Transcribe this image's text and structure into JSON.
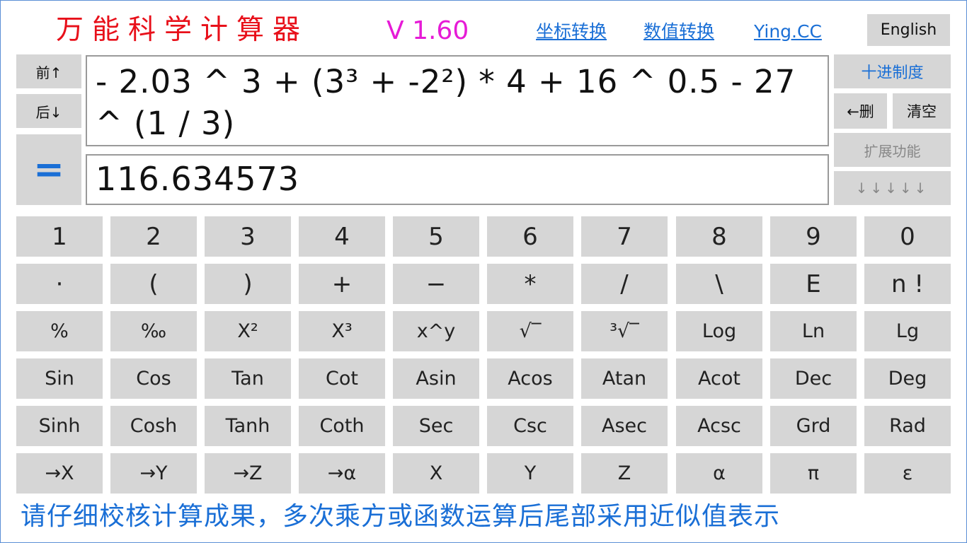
{
  "header": {
    "title": "万能科学计算器",
    "version": "V 1.60",
    "links": [
      "坐标转换",
      "数值转换",
      "Ying.CC"
    ],
    "language_button": "English"
  },
  "left_panel": {
    "prev_label": "前↑",
    "next_label": "后↓",
    "equals_label": "="
  },
  "display": {
    "expression": " - 2.03 ^ 3 + (3³ + -2²) * 4 + 16 ^ 0.5 - 27 ^ (1 / 3)",
    "result": "116.634573"
  },
  "right_panel": {
    "mode_label": "十进制度",
    "delete_label": "←删",
    "clear_label": "清空",
    "extended_label": "扩展功能",
    "arrows_label": "↓↓↓↓↓"
  },
  "keypad": {
    "rows": [
      [
        "1",
        "2",
        "3",
        "4",
        "5",
        "6",
        "7",
        "8",
        "9",
        "0"
      ],
      [
        "·",
        "(",
        ")",
        "+",
        "−",
        "*",
        "/",
        "\\",
        "E",
        "n !"
      ],
      [
        "%",
        "‰",
        "X²",
        "X³",
        "x^y",
        "√‾",
        "³√‾",
        "Log",
        "Ln",
        "Lg"
      ],
      [
        "Sin",
        "Cos",
        "Tan",
        "Cot",
        "Asin",
        "Acos",
        "Atan",
        "Acot",
        "Dec",
        "Deg"
      ],
      [
        "Sinh",
        "Cosh",
        "Tanh",
        "Coth",
        "Sec",
        "Csc",
        "Asec",
        "Acsc",
        "Grd",
        "Rad"
      ],
      [
        "→X",
        "→Y",
        "→Z",
        "→α",
        "X",
        "Y",
        "Z",
        "α",
        "π",
        "ε"
      ]
    ]
  },
  "footer": {
    "note": "请仔细校核计算成果，多次乘方或函数运算后尾部采用近似值表示"
  },
  "colors": {
    "title": "#e8101a",
    "version": "#e61bd6",
    "link": "#1a6fd6",
    "button_bg": "#d6d6d6",
    "equals": "#1a6fd6"
  }
}
